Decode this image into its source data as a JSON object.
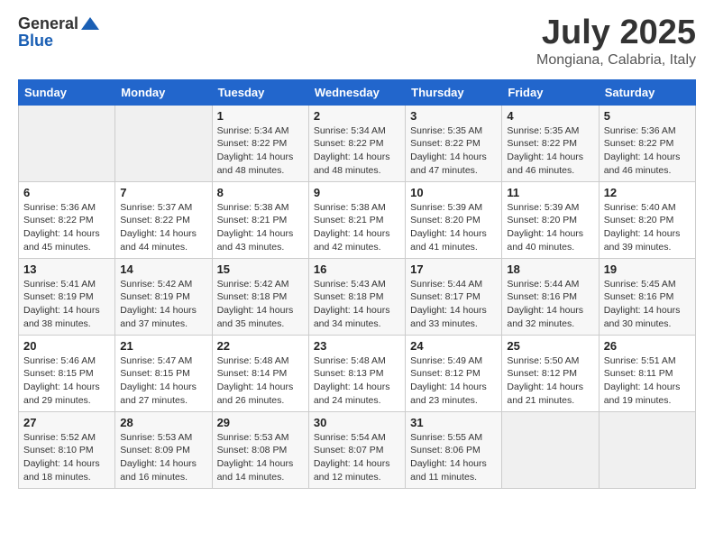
{
  "logo": {
    "general": "General",
    "blue": "Blue"
  },
  "title": {
    "month_year": "July 2025",
    "location": "Mongiana, Calabria, Italy"
  },
  "weekdays": [
    "Sunday",
    "Monday",
    "Tuesday",
    "Wednesday",
    "Thursday",
    "Friday",
    "Saturday"
  ],
  "weeks": [
    [
      {
        "day": "",
        "sunrise": "",
        "sunset": "",
        "daylight": ""
      },
      {
        "day": "",
        "sunrise": "",
        "sunset": "",
        "daylight": ""
      },
      {
        "day": "1",
        "sunrise": "Sunrise: 5:34 AM",
        "sunset": "Sunset: 8:22 PM",
        "daylight": "Daylight: 14 hours and 48 minutes."
      },
      {
        "day": "2",
        "sunrise": "Sunrise: 5:34 AM",
        "sunset": "Sunset: 8:22 PM",
        "daylight": "Daylight: 14 hours and 48 minutes."
      },
      {
        "day": "3",
        "sunrise": "Sunrise: 5:35 AM",
        "sunset": "Sunset: 8:22 PM",
        "daylight": "Daylight: 14 hours and 47 minutes."
      },
      {
        "day": "4",
        "sunrise": "Sunrise: 5:35 AM",
        "sunset": "Sunset: 8:22 PM",
        "daylight": "Daylight: 14 hours and 46 minutes."
      },
      {
        "day": "5",
        "sunrise": "Sunrise: 5:36 AM",
        "sunset": "Sunset: 8:22 PM",
        "daylight": "Daylight: 14 hours and 46 minutes."
      }
    ],
    [
      {
        "day": "6",
        "sunrise": "Sunrise: 5:36 AM",
        "sunset": "Sunset: 8:22 PM",
        "daylight": "Daylight: 14 hours and 45 minutes."
      },
      {
        "day": "7",
        "sunrise": "Sunrise: 5:37 AM",
        "sunset": "Sunset: 8:22 PM",
        "daylight": "Daylight: 14 hours and 44 minutes."
      },
      {
        "day": "8",
        "sunrise": "Sunrise: 5:38 AM",
        "sunset": "Sunset: 8:21 PM",
        "daylight": "Daylight: 14 hours and 43 minutes."
      },
      {
        "day": "9",
        "sunrise": "Sunrise: 5:38 AM",
        "sunset": "Sunset: 8:21 PM",
        "daylight": "Daylight: 14 hours and 42 minutes."
      },
      {
        "day": "10",
        "sunrise": "Sunrise: 5:39 AM",
        "sunset": "Sunset: 8:20 PM",
        "daylight": "Daylight: 14 hours and 41 minutes."
      },
      {
        "day": "11",
        "sunrise": "Sunrise: 5:39 AM",
        "sunset": "Sunset: 8:20 PM",
        "daylight": "Daylight: 14 hours and 40 minutes."
      },
      {
        "day": "12",
        "sunrise": "Sunrise: 5:40 AM",
        "sunset": "Sunset: 8:20 PM",
        "daylight": "Daylight: 14 hours and 39 minutes."
      }
    ],
    [
      {
        "day": "13",
        "sunrise": "Sunrise: 5:41 AM",
        "sunset": "Sunset: 8:19 PM",
        "daylight": "Daylight: 14 hours and 38 minutes."
      },
      {
        "day": "14",
        "sunrise": "Sunrise: 5:42 AM",
        "sunset": "Sunset: 8:19 PM",
        "daylight": "Daylight: 14 hours and 37 minutes."
      },
      {
        "day": "15",
        "sunrise": "Sunrise: 5:42 AM",
        "sunset": "Sunset: 8:18 PM",
        "daylight": "Daylight: 14 hours and 35 minutes."
      },
      {
        "day": "16",
        "sunrise": "Sunrise: 5:43 AM",
        "sunset": "Sunset: 8:18 PM",
        "daylight": "Daylight: 14 hours and 34 minutes."
      },
      {
        "day": "17",
        "sunrise": "Sunrise: 5:44 AM",
        "sunset": "Sunset: 8:17 PM",
        "daylight": "Daylight: 14 hours and 33 minutes."
      },
      {
        "day": "18",
        "sunrise": "Sunrise: 5:44 AM",
        "sunset": "Sunset: 8:16 PM",
        "daylight": "Daylight: 14 hours and 32 minutes."
      },
      {
        "day": "19",
        "sunrise": "Sunrise: 5:45 AM",
        "sunset": "Sunset: 8:16 PM",
        "daylight": "Daylight: 14 hours and 30 minutes."
      }
    ],
    [
      {
        "day": "20",
        "sunrise": "Sunrise: 5:46 AM",
        "sunset": "Sunset: 8:15 PM",
        "daylight": "Daylight: 14 hours and 29 minutes."
      },
      {
        "day": "21",
        "sunrise": "Sunrise: 5:47 AM",
        "sunset": "Sunset: 8:15 PM",
        "daylight": "Daylight: 14 hours and 27 minutes."
      },
      {
        "day": "22",
        "sunrise": "Sunrise: 5:48 AM",
        "sunset": "Sunset: 8:14 PM",
        "daylight": "Daylight: 14 hours and 26 minutes."
      },
      {
        "day": "23",
        "sunrise": "Sunrise: 5:48 AM",
        "sunset": "Sunset: 8:13 PM",
        "daylight": "Daylight: 14 hours and 24 minutes."
      },
      {
        "day": "24",
        "sunrise": "Sunrise: 5:49 AM",
        "sunset": "Sunset: 8:12 PM",
        "daylight": "Daylight: 14 hours and 23 minutes."
      },
      {
        "day": "25",
        "sunrise": "Sunrise: 5:50 AM",
        "sunset": "Sunset: 8:12 PM",
        "daylight": "Daylight: 14 hours and 21 minutes."
      },
      {
        "day": "26",
        "sunrise": "Sunrise: 5:51 AM",
        "sunset": "Sunset: 8:11 PM",
        "daylight": "Daylight: 14 hours and 19 minutes."
      }
    ],
    [
      {
        "day": "27",
        "sunrise": "Sunrise: 5:52 AM",
        "sunset": "Sunset: 8:10 PM",
        "daylight": "Daylight: 14 hours and 18 minutes."
      },
      {
        "day": "28",
        "sunrise": "Sunrise: 5:53 AM",
        "sunset": "Sunset: 8:09 PM",
        "daylight": "Daylight: 14 hours and 16 minutes."
      },
      {
        "day": "29",
        "sunrise": "Sunrise: 5:53 AM",
        "sunset": "Sunset: 8:08 PM",
        "daylight": "Daylight: 14 hours and 14 minutes."
      },
      {
        "day": "30",
        "sunrise": "Sunrise: 5:54 AM",
        "sunset": "Sunset: 8:07 PM",
        "daylight": "Daylight: 14 hours and 12 minutes."
      },
      {
        "day": "31",
        "sunrise": "Sunrise: 5:55 AM",
        "sunset": "Sunset: 8:06 PM",
        "daylight": "Daylight: 14 hours and 11 minutes."
      },
      {
        "day": "",
        "sunrise": "",
        "sunset": "",
        "daylight": ""
      },
      {
        "day": "",
        "sunrise": "",
        "sunset": "",
        "daylight": ""
      }
    ]
  ]
}
